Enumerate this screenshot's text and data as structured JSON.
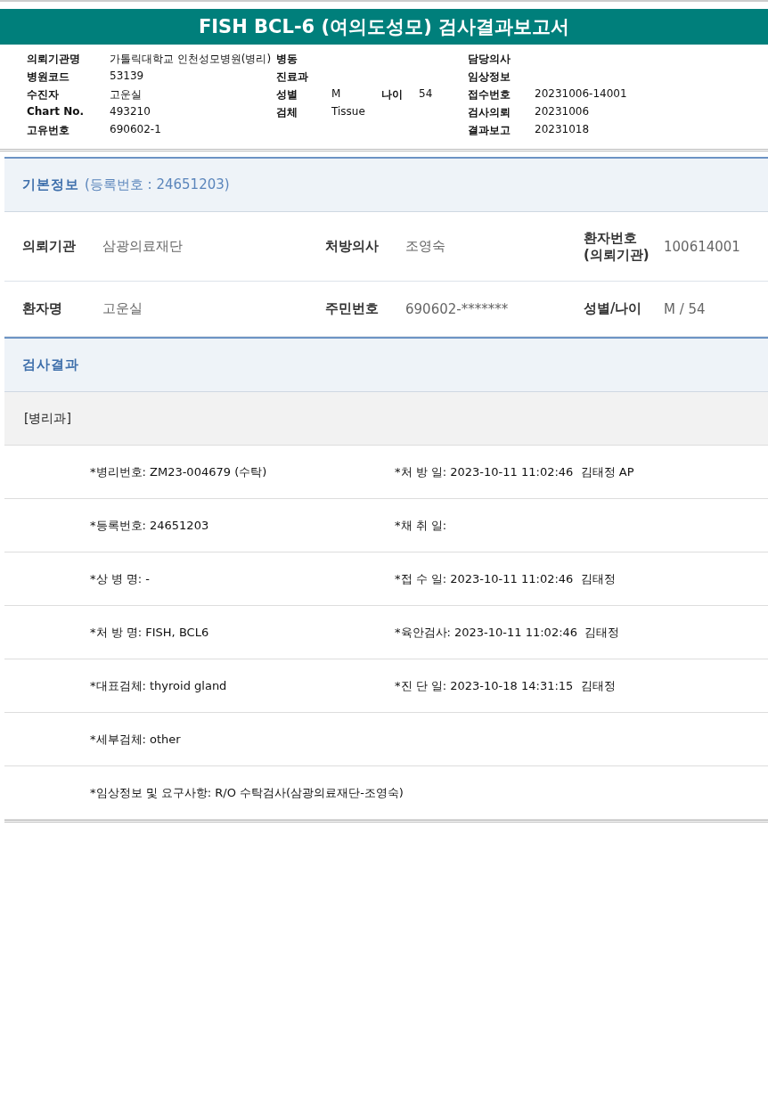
{
  "title": "FISH BCL-6 (여의도성모) 검사결과보고서",
  "header": {
    "rows": [
      {
        "col_1": {
          "label": "의뢰기관명",
          "value": "가톨릭대학교 인천성모병원(병리)"
        },
        "col_2": {
          "label": "병동"
        },
        "col_4": {
          "label": "담당의사"
        }
      },
      {
        "col_1": {
          "label": "병원코드",
          "value": "53139"
        },
        "col_2": {
          "label": "진료과"
        },
        "col_4": {
          "label": "임상정보"
        }
      },
      {
        "col_1": {
          "label": "수진자",
          "value": "고운실"
        },
        "col_2": {
          "label": "성별",
          "value": "M"
        },
        "col_3": {
          "label": "나이",
          "value": "54"
        },
        "col_4": {
          "label": "접수번호",
          "value": "20231006-14001"
        }
      },
      {
        "col_1": {
          "label": "Chart No.",
          "value": "493210"
        },
        "col_2": {
          "label": "검체",
          "value": "Tissue"
        },
        "col_4": {
          "label": "검사의뢰",
          "value": "20231006"
        }
      },
      {
        "col_1": {
          "label": "고유번호",
          "value": "690602-1"
        },
        "col_4": {
          "label": "결과보고",
          "value": "20231018"
        }
      }
    ]
  },
  "basic_info": {
    "heading": "기본정보",
    "subheading": "(등록번호 : 24651203)",
    "rows": [
      [
        {
          "label": "의뢰기관",
          "value": "삼광의료재단"
        },
        {
          "label": "처방의사",
          "value": "조영숙"
        },
        {
          "label": "환자번호\n(의뢰기관)",
          "value": "100614001"
        }
      ],
      [
        {
          "label": "환자명",
          "value": "고운실"
        },
        {
          "label": "주민번호",
          "value": "690602-*******"
        },
        {
          "label": "성별/나이",
          "value": "M / 54"
        }
      ]
    ]
  },
  "results": {
    "heading": "검사결과",
    "department": "[병리과]",
    "rows": [
      {
        "left": "*병리번호: ZM23-004679 (수탁)",
        "right": "*처 방 일: 2023-10-11 11:02:46  김태정 AP"
      },
      {
        "left": "*등록번호: 24651203",
        "right": "*채 취 일:"
      },
      {
        "left": "*상 병 명: -",
        "right": "*접 수 일: 2023-10-11 11:02:46  김태정"
      },
      {
        "left": "*처 방 명: FISH, BCL6",
        "right": "*육안검사: 2023-10-11 11:02:46  김태정"
      },
      {
        "left": "*대표검체: thyroid gland",
        "right": "*진 단 일: 2023-10-18 14:31:15  김태정"
      },
      {
        "left": "*세부검체: other"
      },
      {
        "left": "*임상정보 및 요구사항: R/O 수탁검사(삼광의료재단-조영숙)"
      }
    ]
  }
}
